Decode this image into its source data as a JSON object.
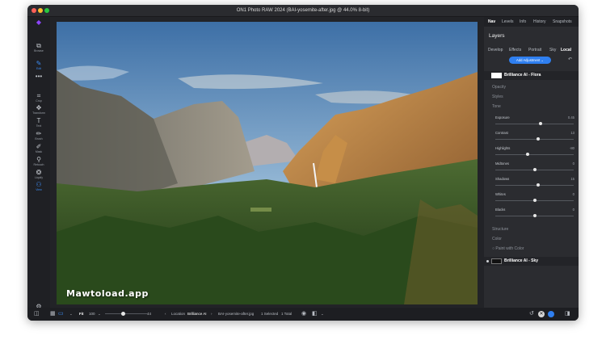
{
  "window": {
    "title": "ON1 Photo RAW 2024 (BAI-yosemite-after.jpg @ 44.0% 8-bit)",
    "traffic_colors": [
      "#ff5f57",
      "#febc2e",
      "#28c840"
    ]
  },
  "toolrail": {
    "items": [
      {
        "label": "Browse",
        "icon": "browse-icon",
        "glyph": "⧉"
      },
      {
        "label": "Edit",
        "icon": "edit-icon",
        "glyph": "✎",
        "active": true
      },
      {
        "label": "",
        "icon": "more-icon",
        "glyph": "•••"
      },
      {
        "label": "Crop",
        "icon": "crop-icon",
        "glyph": "⌗"
      },
      {
        "label": "Transform",
        "icon": "transform-icon",
        "glyph": "✥"
      },
      {
        "label": "Text",
        "icon": "text-icon",
        "glyph": "T"
      },
      {
        "label": "Brush",
        "icon": "brush-icon",
        "glyph": "✏"
      },
      {
        "label": "Mask",
        "icon": "mask-icon",
        "glyph": "✐"
      },
      {
        "label": "Retouch",
        "icon": "retouch-icon",
        "glyph": "⚲"
      },
      {
        "label": "Liquify",
        "icon": "liquify-icon",
        "glyph": "❂"
      },
      {
        "label": "View",
        "icon": "view-icon",
        "glyph": "⚇",
        "active": true
      }
    ],
    "bottom_icon": "settings-icon"
  },
  "watermark": "Mawtoload.app",
  "panel": {
    "nav_tabs": [
      "Nav",
      "Levels",
      "Info",
      "History",
      "Snapshots"
    ],
    "active_nav": "Nav",
    "layers_title": "Layers",
    "sub_tabs": [
      "Develop",
      "Effects",
      "Portrait",
      "Sky",
      "Local"
    ],
    "active_sub": "Local",
    "add_adjustment": "Add Adjustment ⌄",
    "layers": [
      {
        "name": "Brilliance AI - Flora"
      },
      {
        "name": "Brilliance AI - Sky"
      }
    ],
    "sections": [
      "Opacity",
      "Styles",
      "Tone"
    ],
    "sliders": [
      {
        "label": "Exposure",
        "value": "0.45",
        "fraction": 0.58
      },
      {
        "label": "Contrast",
        "value": "13",
        "fraction": 0.55
      },
      {
        "label": "Highlights",
        "value": "-80",
        "fraction": 0.41
      },
      {
        "label": "Midtones",
        "value": "0",
        "fraction": 0.5
      },
      {
        "label": "Shadows",
        "value": "15",
        "fraction": 0.55
      },
      {
        "label": "Whites",
        "value": "0",
        "fraction": 0.5
      },
      {
        "label": "Blacks",
        "value": "0",
        "fraction": 0.5
      }
    ],
    "extra_sections": [
      "Structure",
      "Color"
    ],
    "paint_with_color": "Paint with Color"
  },
  "statusbar": {
    "fit": "Fit",
    "zoom": "100",
    "zoom_value": "44",
    "zoom_fraction": 0.44,
    "location_label": "Location",
    "location": "Brilliance AI",
    "filename": "BAI-yosemite-after.jpg",
    "selected": "1 Selected",
    "total": "1 Total"
  },
  "colors": {
    "accent": "#2f7ff0",
    "panel_bg": "#2b2c30",
    "window_bg": "#222327"
  }
}
